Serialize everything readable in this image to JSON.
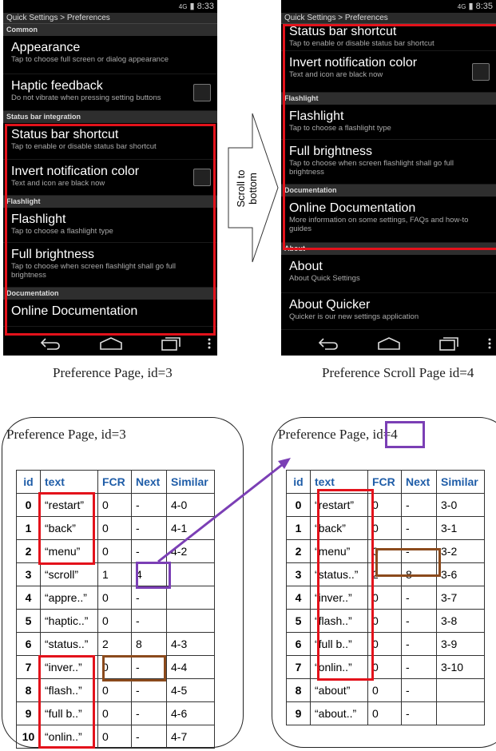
{
  "left_phone": {
    "status_time": "8:33",
    "signal": "4G",
    "title": "Quick Settings > Preferences",
    "sections": [
      {
        "label": "Common"
      },
      {
        "label": "Status bar integration"
      },
      {
        "label": "Flashlight"
      },
      {
        "label": "Documentation"
      }
    ],
    "items": [
      {
        "title": "Appearance",
        "sub": "Tap to choose full screen or dialog appearance"
      },
      {
        "title": "Haptic feedback",
        "sub": "Do not vibrate when pressing setting buttons"
      },
      {
        "title": "Status bar shortcut",
        "sub": "Tap to enable or disable status bar shortcut"
      },
      {
        "title": "Invert notification color",
        "sub": "Text and icon are black now"
      },
      {
        "title": "Flashlight",
        "sub": "Tap to choose a flashlight type"
      },
      {
        "title": "Full brightness",
        "sub": "Tap to choose when screen flashlight shall go full brightness"
      },
      {
        "title": "Online Documentation",
        "sub": ""
      }
    ]
  },
  "right_phone": {
    "status_time": "8:35",
    "signal": "4G",
    "title": "Quick Settings > Preferences",
    "sections": [
      {
        "label": "Flashlight"
      },
      {
        "label": "Documentation"
      },
      {
        "label": "About"
      }
    ],
    "items": [
      {
        "title": "Status bar shortcut",
        "sub": "Tap to enable or disable status bar shortcut"
      },
      {
        "title": "Invert notification color",
        "sub": "Text and icon are black now"
      },
      {
        "title": "Flashlight",
        "sub": "Tap to choose a flashlight type"
      },
      {
        "title": "Full brightness",
        "sub": "Tap to choose when screen flashlight shall go full brightness"
      },
      {
        "title": "Online Documentation",
        "sub": "More information on some settings, FAQs and how-to guides"
      },
      {
        "title": "About",
        "sub": "About Quick Settings"
      },
      {
        "title": "About Quicker",
        "sub": "Quicker is our new settings application"
      }
    ]
  },
  "scroll_arrow": {
    "line1": "Scroll to",
    "line2": "bottom"
  },
  "captions": {
    "left": "Preference Page, id=3",
    "right": "Preference Scroll Page id=4"
  },
  "left_table": {
    "title": "Preference Page, id=3",
    "headers": [
      "id",
      "text",
      "FCR",
      "Next",
      "Similar"
    ],
    "rows": [
      [
        "0",
        "“restart”",
        "0",
        "-",
        "4-0"
      ],
      [
        "1",
        "“back”",
        "0",
        "-",
        "4-1"
      ],
      [
        "2",
        "“menu”",
        "0",
        "-",
        "4-2"
      ],
      [
        "3",
        "“scroll”",
        "1",
        "4",
        ""
      ],
      [
        "4",
        "“appre..”",
        "0",
        "-",
        ""
      ],
      [
        "5",
        "“haptic..”",
        "0",
        "-",
        ""
      ],
      [
        "6",
        "“status..”",
        "2",
        "8",
        "4-3"
      ],
      [
        "7",
        "“inver..”",
        "0",
        "-",
        "4-4"
      ],
      [
        "8",
        "“flash..”",
        "0",
        "-",
        "4-5"
      ],
      [
        "9",
        "“full b..”",
        "0",
        "-",
        "4-6"
      ],
      [
        "10",
        "“onlin..”",
        "0",
        "-",
        "4-7"
      ]
    ]
  },
  "right_table": {
    "title_prefix": "Preference Page, ",
    "title_id": "id=4",
    "headers": [
      "id",
      "text",
      "FCR",
      "Next",
      "Similar"
    ],
    "rows": [
      [
        "0",
        "“restart”",
        "0",
        "-",
        "3-0"
      ],
      [
        "1",
        "“back”",
        "0",
        "-",
        "3-1"
      ],
      [
        "2",
        "“menu”",
        "0",
        "-",
        "3-2"
      ],
      [
        "3",
        "“status..”",
        "2",
        "8",
        "3-6"
      ],
      [
        "4",
        "“inver..”",
        "0",
        "-",
        "3-7"
      ],
      [
        "5",
        "“flash..”",
        "0",
        "-",
        "3-8"
      ],
      [
        "6",
        "“full b..”",
        "0",
        "-",
        "3-9"
      ],
      [
        "7",
        "“onlin..”",
        "0",
        "-",
        "3-10"
      ],
      [
        "8",
        "“about”",
        "0",
        "-",
        ""
      ],
      [
        "9",
        "“about..”",
        "0",
        "-",
        ""
      ]
    ]
  },
  "colors": {
    "highlight_red": "#e3121b",
    "purple": "#7b3fb5",
    "brown": "#8b4a1c",
    "header_blue": "#1f5da8"
  }
}
